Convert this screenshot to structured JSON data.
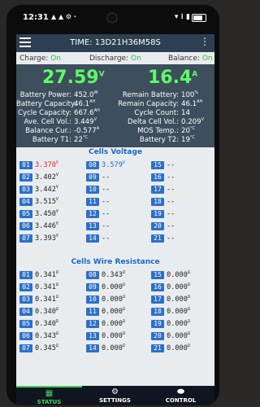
{
  "status_bar": {
    "time": "12:31",
    "icons": "▲ ▲ ⚙ ·",
    "right_icons": "▾ ⁝ ▮"
  },
  "app": {
    "title": "TIME: 13D21H36M58S",
    "charge_label": "Charge:",
    "charge_value": "On",
    "discharge_label": "Discharge:",
    "discharge_value": "On",
    "balance_label": "Balance:",
    "balance_value": "On"
  },
  "summary": {
    "voltage": "27.59",
    "voltage_unit": "V",
    "current": "16.4",
    "current_unit": "A",
    "left": [
      {
        "label": "Battery Power:",
        "value": "452.0",
        "unit": "W"
      },
      {
        "label": "Battery Capacity:",
        "value": "46.1",
        "unit": "AH"
      },
      {
        "label": "Cycle Capacity:",
        "value": "667.6",
        "unit": "AH"
      },
      {
        "label": "Ave. Cell Vol.:",
        "value": "3.449",
        "unit": "V"
      },
      {
        "label": "Balance Cur.:",
        "value": "-0.577",
        "unit": "A"
      },
      {
        "label": "Battery T1:",
        "value": "22",
        "unit": "°C"
      }
    ],
    "right": [
      {
        "label": "Remain Battery:",
        "value": "100",
        "unit": "%"
      },
      {
        "label": "Remain Capacity:",
        "value": "46.1",
        "unit": "AH"
      },
      {
        "label": "Cycle Count:",
        "value": "14",
        "unit": ""
      },
      {
        "label": "Delta Cell Vol.:",
        "value": "0.209",
        "unit": "V"
      },
      {
        "label": "MOS Temp.:",
        "value": "20",
        "unit": "°C"
      },
      {
        "label": "Battery T2:",
        "value": "19",
        "unit": "°C"
      }
    ]
  },
  "cells_voltage": {
    "title": "Cells Voltage",
    "cells": [
      {
        "idx": "01",
        "value": "3.370",
        "unit": "V"
      },
      {
        "idx": "02",
        "value": "3.402",
        "unit": "V"
      },
      {
        "idx": "03",
        "value": "3.442",
        "unit": "V"
      },
      {
        "idx": "04",
        "value": "3.515",
        "unit": "V"
      },
      {
        "idx": "05",
        "value": "3.450",
        "unit": "V"
      },
      {
        "idx": "06",
        "value": "3.446",
        "unit": "V"
      },
      {
        "idx": "07",
        "value": "3.393",
        "unit": "V"
      },
      {
        "idx": "08",
        "value": "3.579",
        "unit": "V"
      },
      {
        "idx": "09",
        "value": "--",
        "unit": ""
      },
      {
        "idx": "10",
        "value": "--",
        "unit": ""
      },
      {
        "idx": "11",
        "value": "--",
        "unit": ""
      },
      {
        "idx": "12",
        "value": "--",
        "unit": ""
      },
      {
        "idx": "13",
        "value": "--",
        "unit": ""
      },
      {
        "idx": "14",
        "value": "--",
        "unit": ""
      },
      {
        "idx": "15",
        "value": "--",
        "unit": ""
      },
      {
        "idx": "16",
        "value": "--",
        "unit": ""
      },
      {
        "idx": "17",
        "value": "--",
        "unit": ""
      },
      {
        "idx": "18",
        "value": "--",
        "unit": ""
      },
      {
        "idx": "19",
        "value": "--",
        "unit": ""
      },
      {
        "idx": "20",
        "value": "--",
        "unit": ""
      },
      {
        "idx": "21",
        "value": "--",
        "unit": ""
      }
    ]
  },
  "cells_resistance": {
    "title": "Cells Wire Resistance",
    "cells": [
      {
        "idx": "01",
        "value": "0.341",
        "unit": "Ω"
      },
      {
        "idx": "02",
        "value": "0.341",
        "unit": "Ω"
      },
      {
        "idx": "03",
        "value": "0.341",
        "unit": "Ω"
      },
      {
        "idx": "04",
        "value": "0.340",
        "unit": "Ω"
      },
      {
        "idx": "05",
        "value": "0.340",
        "unit": "Ω"
      },
      {
        "idx": "06",
        "value": "0.343",
        "unit": "Ω"
      },
      {
        "idx": "07",
        "value": "0.345",
        "unit": "Ω"
      },
      {
        "idx": "08",
        "value": "0.343",
        "unit": "Ω"
      },
      {
        "idx": "09",
        "value": "0.000",
        "unit": "Ω"
      },
      {
        "idx": "10",
        "value": "0.000",
        "unit": "Ω"
      },
      {
        "idx": "11",
        "value": "0.000",
        "unit": "Ω"
      },
      {
        "idx": "12",
        "value": "0.000",
        "unit": "Ω"
      },
      {
        "idx": "13",
        "value": "0.000",
        "unit": "Ω"
      },
      {
        "idx": "14",
        "value": "0.000",
        "unit": "Ω"
      },
      {
        "idx": "15",
        "value": "0.000",
        "unit": "Ω"
      },
      {
        "idx": "16",
        "value": "0.000",
        "unit": "Ω"
      },
      {
        "idx": "17",
        "value": "0.000",
        "unit": "Ω"
      },
      {
        "idx": "18",
        "value": "0.000",
        "unit": "Ω"
      },
      {
        "idx": "19",
        "value": "0.000",
        "unit": "Ω"
      },
      {
        "idx": "20",
        "value": "0.000",
        "unit": "Ω"
      },
      {
        "idx": "21",
        "value": "0.000",
        "unit": "Ω"
      }
    ]
  },
  "nav": [
    {
      "label": "STATUS",
      "icon": "status-icon",
      "glyph": "▦",
      "active": true
    },
    {
      "label": "SETTINGS",
      "icon": "gear-icon",
      "glyph": "⚙",
      "active": false
    },
    {
      "label": "CONTROL",
      "icon": "toggle-icon",
      "glyph": "⬬",
      "active": false
    }
  ],
  "colors": {
    "accent_green": "#5cff62",
    "index_blue": "#2d70c8",
    "min_red": "#e0242a",
    "max_blue": "#1f64c4",
    "header": "#2d3f52"
  }
}
